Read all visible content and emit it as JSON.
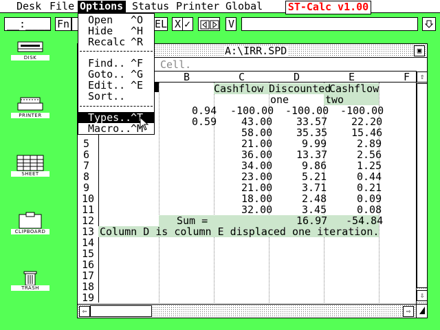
{
  "menubar": {
    "items": [
      "Desk",
      "File",
      "Options",
      "Status",
      "Printer",
      "Global"
    ],
    "app_title": "ST-Calc v1.00"
  },
  "toolbar": {
    "cell_ref": "__:____",
    "fn_label": "Fn",
    "cel_label": "EL",
    "x_label": "X",
    "check_label": "✓",
    "v_label": "V"
  },
  "desktop_icons": [
    "DISK",
    "PRINTER",
    "SHEET",
    "CLIPBOARD",
    "TRASH"
  ],
  "window": {
    "title": "A:\\IRR.SPD",
    "cell_prompt": "Cell."
  },
  "columns": [
    "B",
    "C",
    "D",
    "E",
    "F"
  ],
  "rows": [
    "5",
    "6",
    "7",
    "8",
    "9",
    "10",
    "11",
    "12",
    "13",
    "14",
    "15",
    "16",
    "17",
    "18",
    "19"
  ],
  "options_menu": {
    "group1": [
      [
        "Open",
        "^O"
      ],
      [
        "Hide",
        "^H"
      ],
      [
        "Recalc",
        "^R"
      ]
    ],
    "group2": [
      [
        "Find..",
        "^F"
      ],
      [
        "Goto..",
        "^G"
      ],
      [
        "Edit..",
        "^E"
      ],
      [
        "Sort..",
        ""
      ]
    ],
    "group3": [
      [
        "Types..",
        "^T"
      ],
      [
        "Macro..",
        "^M"
      ]
    ]
  },
  "sheet": {
    "header_c": "Cashflow",
    "header_d": "Discounted",
    "header_e": "Cashflow",
    "sub_d": "one",
    "sub_e": "two",
    "row3": [
      "0.94",
      "-100.00",
      "-100.00",
      "-100.00"
    ],
    "row4": [
      "0.59",
      "43.00",
      "33.57",
      "22.20"
    ],
    "data": [
      [
        "58.00",
        "35.35",
        "15.46"
      ],
      [
        "21.00",
        "9.99",
        "2.89"
      ],
      [
        "36.00",
        "13.37",
        "2.56"
      ],
      [
        "34.00",
        "9.86",
        "1.25"
      ],
      [
        "23.00",
        "5.21",
        "0.44"
      ],
      [
        "21.00",
        "3.71",
        "0.21"
      ],
      [
        "18.00",
        "2.48",
        "0.09"
      ],
      [
        "32.00",
        "3.45",
        "0.08"
      ]
    ],
    "sum_label": "Sum =",
    "sum_d": "16.97",
    "sum_e": "-54.84",
    "note": "Column D is column E displaced one iteration."
  }
}
